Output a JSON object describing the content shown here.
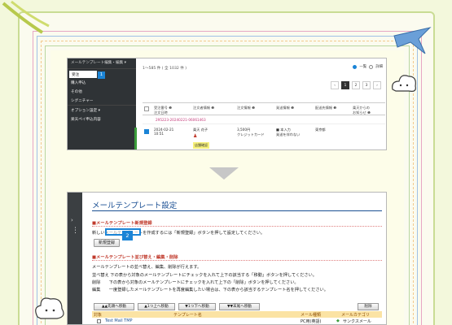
{
  "screenshot1": {
    "sidebar": {
      "header": "メールテンプレート編集・編集 ▾",
      "items": [
        "受注",
        "購入申込",
        "その他",
        "シグニチャー",
        "オプション設定 ▾",
        "楽天ペイ申込内容"
      ],
      "badge": "1"
    },
    "result_info": "1〜585 件 ( 全 1032 件 )",
    "view_toggle": [
      "一覧",
      "詳細"
    ],
    "pager": [
      "‹",
      "1",
      "2",
      "3",
      "›"
    ],
    "columns": [
      "受注番号 ❶\n注文日時",
      "注文者情報 ❶",
      "注文情報 ❶",
      "発送情報 ❶",
      "配送先情報 ❶",
      "楽天からの\nお知らせ ❶"
    ],
    "order_no": "295223-20240221-06061463",
    "row": {
      "date": "2024-02-21\n10:51",
      "buyer": "楽天 花子",
      "payment": "3,500円\nクレジットカード",
      "shipping": "■ 本入力\n発送を伴わない",
      "address": "東京都",
      "tag": "店舗確認"
    }
  },
  "screenshot2": {
    "title": "メールテンプレート設定",
    "sec_new": "■メールテンプレート新規登録",
    "new_text": "新しいメールテンプレートを作成するには「新規登録」ボタンを押して設定してください。",
    "new_button": "新規登録",
    "badge": "2",
    "sec_sort": "■メールテンプレート並び替え・編集・削除",
    "desc": [
      "メールテンプレートの並べ替え、編集、削除が行えます。",
      "並べ替え 下の表から対象のメールテンプレートにチェックを入れて上下の該当する「移動」ボタンを押してください。",
      "削除　　下の表から対象のメールテンプレートにチェックを入れて上下の「削除」ボタンを押してください。",
      "編集　　一度登録したメールテンプレートを再度編集したい場合は、下の表から該当するテンプレート名を押してください。"
    ],
    "move_buttons": [
      "▲▲先頭へ移動",
      "▲1つ上へ移動",
      "▼1つ下へ移動",
      "▼▼末尾へ移動"
    ],
    "delete_button": "削除",
    "table_headers": [
      "対象",
      "テンプレート名",
      "メール種類",
      "メールカテゴリ"
    ],
    "row": {
      "name": "Test Mail TMP",
      "type": "PC用(英語)",
      "category": "サンクスメール"
    }
  }
}
